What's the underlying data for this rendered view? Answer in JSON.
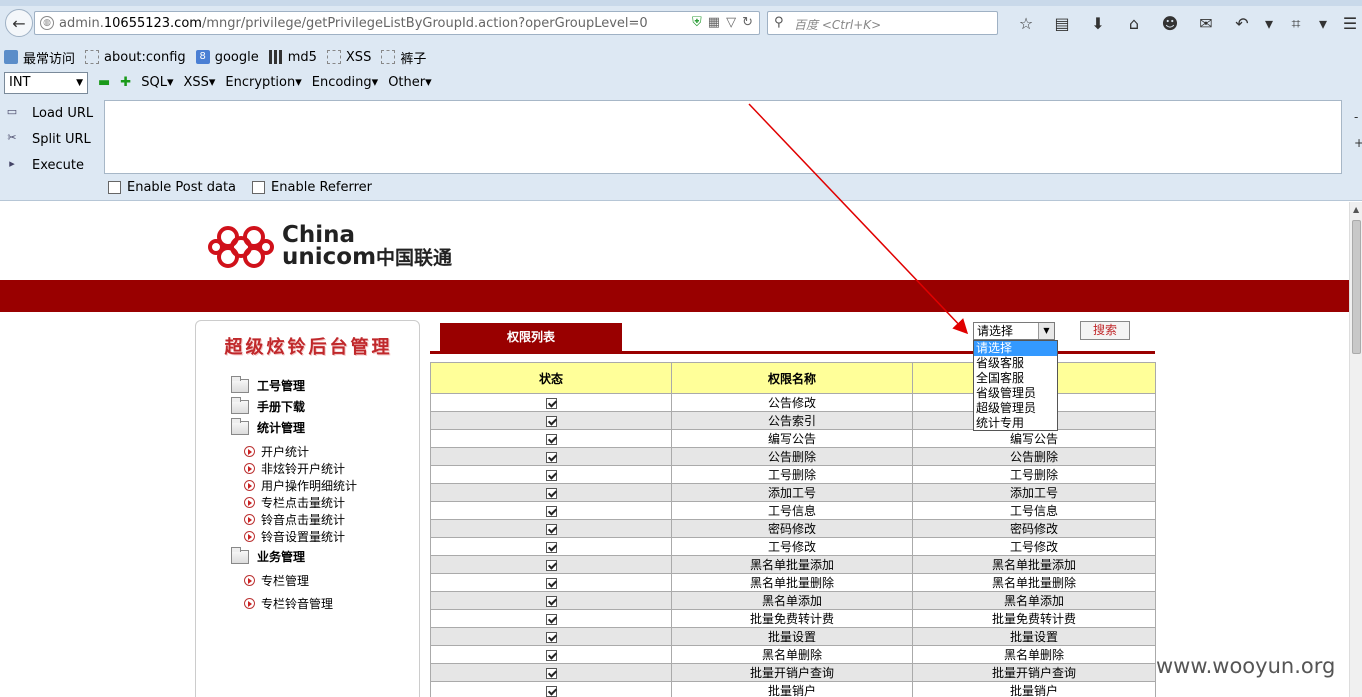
{
  "browser": {
    "url_prefix": "admin.",
    "url_host": "10655123.com",
    "url_path": "/mngr/privilege/getPrivilegeListByGroupId.action?operGroupLevel=0",
    "search_placeholder": "百度 <Ctrl+K>"
  },
  "bookmarks": [
    {
      "label": "最常访问"
    },
    {
      "label": "about:config"
    },
    {
      "label": "google"
    },
    {
      "label": "md5"
    },
    {
      "label": "XSS"
    },
    {
      "label": "裤子"
    }
  ],
  "hackbar": {
    "type_select": "INT",
    "menus": [
      "SQL",
      "XSS",
      "Encryption",
      "Encoding",
      "Other"
    ],
    "load_url": "Load URL",
    "split_url": "Split URL",
    "execute": "Execute",
    "enable_post": "Enable Post data",
    "enable_referrer": "Enable Referrer"
  },
  "logo": {
    "china": "China",
    "unicom": "unicom",
    "cn": "中国联通"
  },
  "sidebar": {
    "title": "超级炫铃后台管理",
    "groups": [
      {
        "label": "工号管理"
      },
      {
        "label": "手册下载"
      },
      {
        "label": "统计管理"
      },
      {
        "label": "业务管理"
      }
    ],
    "stats_items": [
      "开户统计",
      "非炫铃开户统计",
      "用户操作明细统计",
      "专栏点击量统计",
      "铃音点击量统计",
      "铃音设置量统计"
    ],
    "biz_items": [
      "专栏管理",
      "专栏铃音管理"
    ]
  },
  "main": {
    "tab_label": "权限列表",
    "select_value": "请选择",
    "search_button": "搜索",
    "dropdown_options": [
      "请选择",
      "省级客服",
      "全国客服",
      "省级管理员",
      "超级管理员",
      "统计专用"
    ],
    "columns": [
      "状态",
      "权限名称",
      ""
    ],
    "rows": [
      [
        "公告修改",
        ""
      ],
      [
        "公告索引",
        ""
      ],
      [
        "编写公告",
        "编写公告"
      ],
      [
        "公告删除",
        "公告删除"
      ],
      [
        "工号删除",
        "工号删除"
      ],
      [
        "添加工号",
        "添加工号"
      ],
      [
        "工号信息",
        "工号信息"
      ],
      [
        "密码修改",
        "密码修改"
      ],
      [
        "工号修改",
        "工号修改"
      ],
      [
        "黑名单批量添加",
        "黑名单批量添加"
      ],
      [
        "黑名单批量删除",
        "黑名单批量删除"
      ],
      [
        "黑名单添加",
        "黑名单添加"
      ],
      [
        "批量免费转计费",
        "批量免费转计费"
      ],
      [
        "批量设置",
        "批量设置"
      ],
      [
        "黑名单删除",
        "黑名单删除"
      ],
      [
        "批量开销户查询",
        "批量开销户查询"
      ],
      [
        "批量销户",
        "批量销户"
      ]
    ]
  },
  "watermark": "www.wooyun.org",
  "colors": {
    "brand_red": "#990000",
    "header_yellow": "#ffff99",
    "select_blue": "#3399ff"
  }
}
